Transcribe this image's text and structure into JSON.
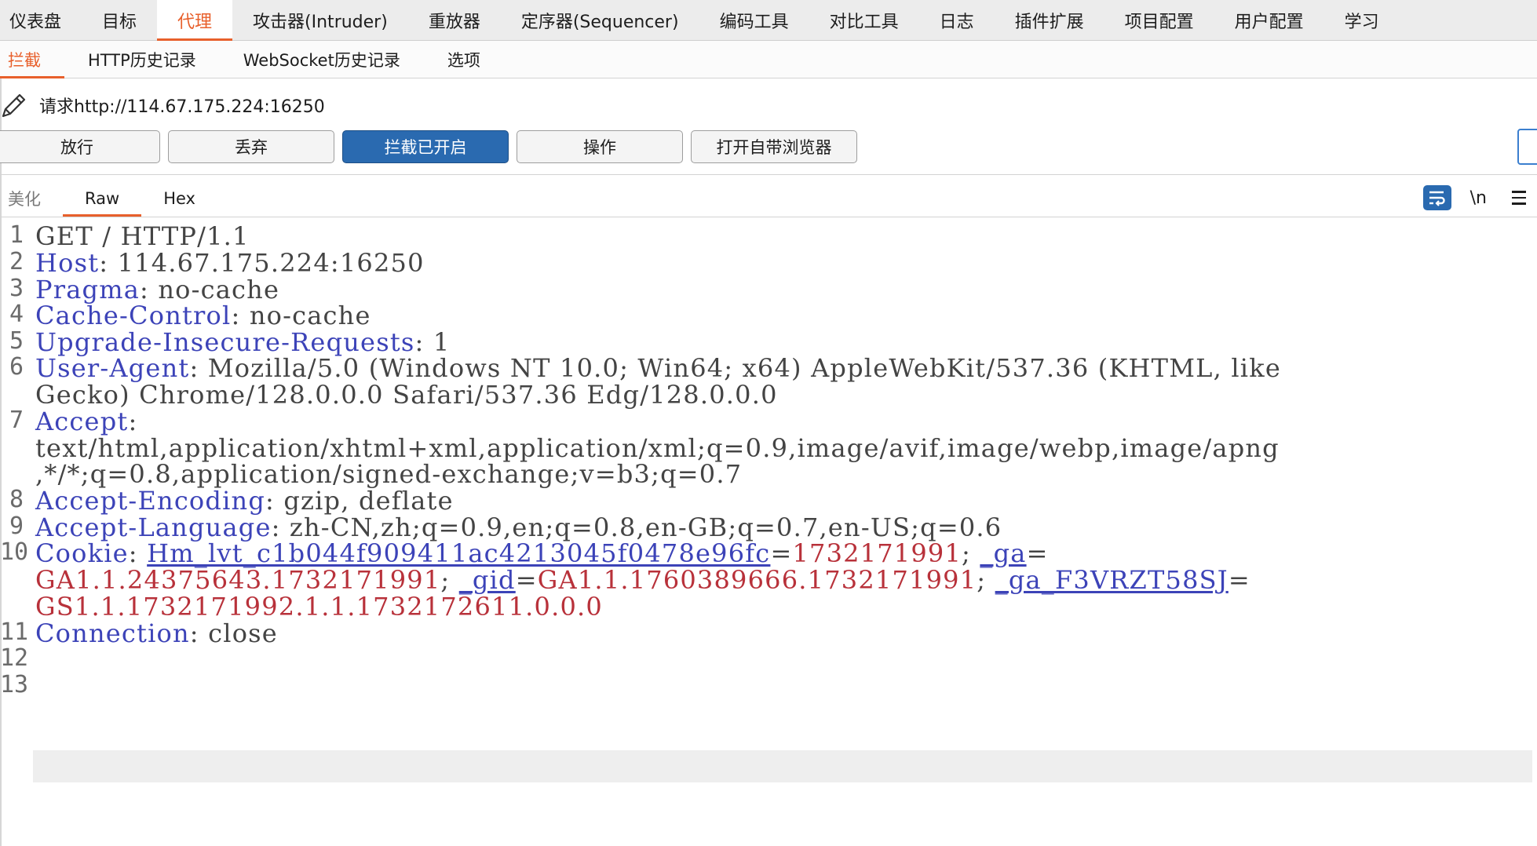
{
  "topnav": {
    "tabs": [
      {
        "label": "仪表盘",
        "active": false
      },
      {
        "label": "目标",
        "active": false
      },
      {
        "label": "代理",
        "active": true
      },
      {
        "label": "攻击器(Intruder)",
        "active": false
      },
      {
        "label": "重放器",
        "active": false
      },
      {
        "label": "定序器(Sequencer)",
        "active": false
      },
      {
        "label": "编码工具",
        "active": false
      },
      {
        "label": "对比工具",
        "active": false
      },
      {
        "label": "日志",
        "active": false
      },
      {
        "label": "插件扩展",
        "active": false
      },
      {
        "label": "项目配置",
        "active": false
      },
      {
        "label": "用户配置",
        "active": false
      },
      {
        "label": "学习",
        "active": false
      }
    ]
  },
  "subnav": {
    "tabs": [
      {
        "label": "拦截",
        "active": true
      },
      {
        "label": "HTTP历史记录",
        "active": false
      },
      {
        "label": "WebSocket历史记录",
        "active": false
      },
      {
        "label": "选项",
        "active": false
      }
    ]
  },
  "request": {
    "label": "请求http://114.67.175.224:16250"
  },
  "buttons": {
    "forward": "放行",
    "drop": "丢弃",
    "intercept": "拦截已开启",
    "action": "操作",
    "browser": "打开自带浏览器"
  },
  "viewtabs": {
    "pretty": "美化",
    "raw": "Raw",
    "hex": "Hex",
    "newline": "\\n"
  },
  "editor": {
    "line_numbers": [
      "1",
      "2",
      "3",
      "4",
      "5",
      "6",
      "7",
      "8",
      "9",
      "10",
      "11",
      "12",
      "13"
    ],
    "request_line": "GET / HTTP/1.1",
    "host_key": "Host",
    "host_val": " 114.67.175.224:16250",
    "pragma_key": "Pragma",
    "pragma_val": " no-cache",
    "cache_key": "Cache-Control",
    "cache_val": " no-cache",
    "uir_key": "Upgrade-Insecure-Requests",
    "uir_val": " 1",
    "ua_key": "User-Agent",
    "ua_val_1": " Mozilla/5.0 (Windows NT 10.0; Win64; x64) AppleWebKit/537.36 (KHTML, like",
    "ua_val_2": "Gecko) Chrome/128.0.0.0 Safari/537.36 Edg/128.0.0.0",
    "accept_key": "Accept",
    "accept_val_1": "text/html,application/xhtml+xml,application/xml;q=0.9,image/avif,image/webp,image/apng",
    "accept_val_2": ",*/*;q=0.8,application/signed-exchange;v=b3;q=0.7",
    "ae_key": "Accept-Encoding",
    "ae_val": " gzip, deflate",
    "al_key": "Accept-Language",
    "al_val": " zh-CN,zh;q=0.9,en;q=0.8,en-GB;q=0.7,en-US;q=0.6",
    "cookie_key": "Cookie",
    "c1_name": "Hm_lvt_c1b044f909411ac4213045f0478e96fc",
    "c1_val": "1732171991",
    "c2_name": "_ga",
    "c2_val": "GA1.1.24375643.1732171991",
    "c3_name": "_gid",
    "c3_val": "GA1.1.1760389666.1732171991",
    "c4_name": "_ga_F3VRZT58SJ",
    "c4_val": "GS1.1.1732171992.1.1.1732172611.0.0.0",
    "conn_key": "Connection",
    "conn_val": " close"
  },
  "colors": {
    "accent": "#e8602c",
    "primary_button": "#2a6ab0",
    "header_key": "#3c43b8",
    "cookie_value": "#b8313a"
  }
}
